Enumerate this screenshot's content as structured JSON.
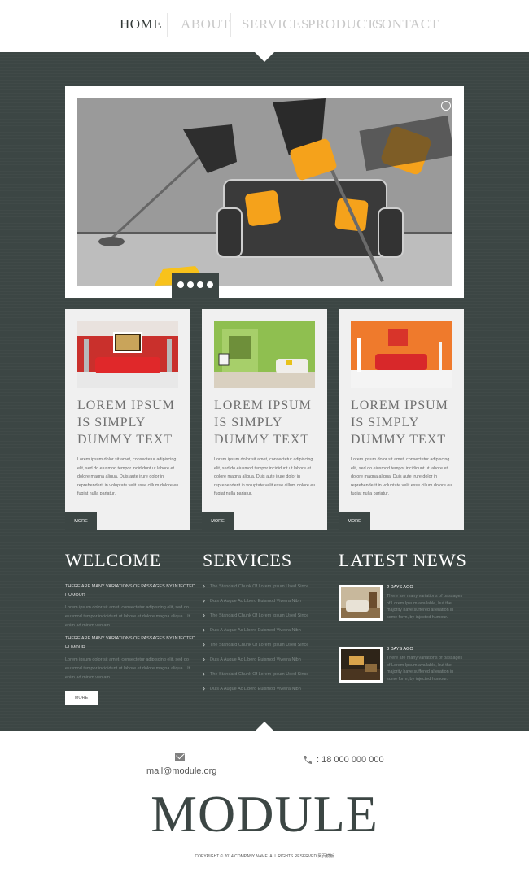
{
  "nav": {
    "items": [
      {
        "label": "HOME"
      },
      {
        "label": "ABOUT"
      },
      {
        "label": "SERVICES"
      },
      {
        "label": "PRODUCTS"
      },
      {
        "label": "CONTACT"
      }
    ],
    "active": "HOME"
  },
  "colors": {
    "dark_bg": "#3c4644",
    "accent_orange": "#f5a21b",
    "card_bg": "#f0f0f0",
    "white": "#ffffff"
  },
  "slider": {
    "dots": 4,
    "active_dot": 1
  },
  "cards": [
    {
      "title_lines": [
        "LOREM IPSUM",
        "IS SIMPLY",
        "DUMMY TEXT"
      ],
      "body": "Lorem ipsum dolor sit amet, consectetur adipiscing elit, sed do eiusmod tempor incididunt ut labore et dolore magna aliqua. Duis aute irure dolor in reprehenderit in voluptate velit esse cillum dolore eu fugiat nulla pariatur.",
      "more": "MORE"
    },
    {
      "title_lines": [
        "LOREM IPSUM",
        "IS SIMPLY",
        "DUMMY TEXT"
      ],
      "body": "Lorem ipsum dolor sit amet, consectetur adipiscing elit, sed do eiusmod tempor incididunt ut labore et dolore magna aliqua. Duis aute irure dolor in reprehenderit in voluptate velit esse cillum dolore eu fugiat nulla pariatur.",
      "more": "MORE"
    },
    {
      "title_lines": [
        "LOREM IPSUM",
        "IS SIMPLY",
        "DUMMY TEXT"
      ],
      "body": "Lorem ipsum dolor sit amet, consectetur adipiscing elit, sed do eiusmod tempor incididunt ut labore et dolore magna aliqua. Duis aute irure dolor in reprehenderit in voluptate velit esse cillum dolore eu fugiat nulla pariatur.",
      "more": "MORE"
    }
  ],
  "welcome": {
    "title": "WELCOME",
    "heading1": "THERE ARE MANY VARIATIONS OF PASSAGES BY INJECTED HUMOUR",
    "text1": "Lorem ipsum dolor sit amet, consectetur adipiscing elit, sed do eiusmod tempor incididunt ut labore et dolore magna aliqua. Ut enim ad minim veniam.",
    "heading2": "THERE ARE MANY VARIATIONS OF PASSAGES BY INJECTED HUMOUR",
    "text2": "Lorem ipsum dolor sit amet, consectetur adipiscing elit, sed do eiusmod tempor incididunt ut labore et dolore magna aliqua. Ut enim ad minim veniam.",
    "more": "MORE"
  },
  "services": {
    "title": "SERVICES",
    "items": [
      "The Standard Chunk Of Lorem Ipsum Used Since",
      "Duis A Augue Ac Libero Euismod Viverra Nibh",
      "The Standard Chunk Of Lorem Ipsum Used Since",
      "Duis A Augue Ac Libero Euismod Viverra Nibh",
      "The Standard Chunk Of Lorem Ipsum Used Since",
      "Duis A Augue Ac Libero Euismod Viverra Nibh",
      "The Standard Chunk Of Lorem Ipsum Used Since",
      "Duis A Augue Ac Libero Euismod Viverra Nibh"
    ]
  },
  "news": {
    "title": "LATEST NEWS",
    "items": [
      {
        "date": "2 DAYS AGO",
        "text": "There are many variations of passages of Lorem Ipsum available, but the majority have suffered alteration in some form, by injected humour."
      },
      {
        "date": "3 DAYS AGO",
        "text": "There are many variations of passages of Lorem Ipsum available, but the majority have suffered alteration in some form, by injected humour."
      }
    ]
  },
  "footer": {
    "email": "mail@module.org",
    "phone": ": 18 000 000 000",
    "logo": "MODULE",
    "copyright": "COPYRIGHT © 2014 COMPANY NAME. ALL RIGHTS RESERVED 网页模板"
  },
  "icons": [
    "mail-icon",
    "phone-icon",
    "chevron-right-icon"
  ]
}
